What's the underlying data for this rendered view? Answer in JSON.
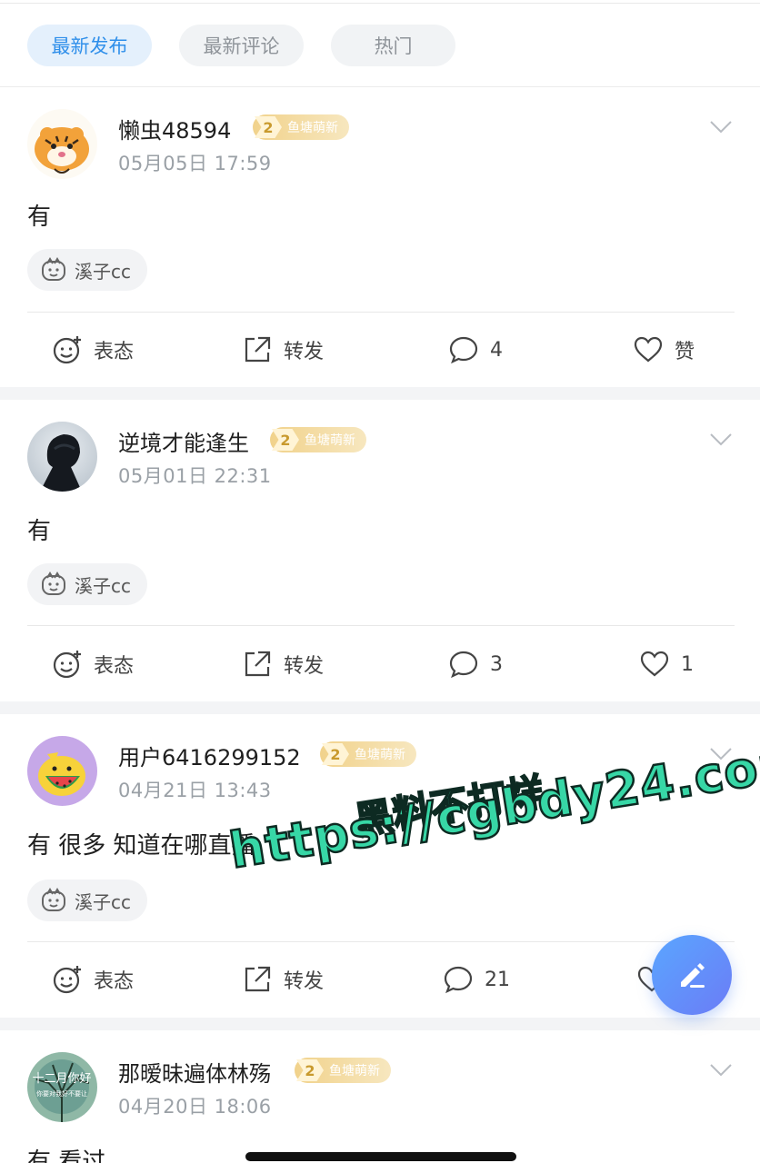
{
  "tabs": [
    {
      "label": "最新发布",
      "active": true
    },
    {
      "label": "最新评论",
      "active": false
    },
    {
      "label": "热门",
      "active": false
    }
  ],
  "posts": [
    {
      "username": "懒虫48594",
      "badge_level": "2",
      "badge_text": "鱼塘萌新",
      "time": "05月05日 17:59",
      "content": "有",
      "topic": "溪子cc",
      "actions": {
        "react": "表态",
        "share": "转发",
        "comments": "4",
        "like": "赞"
      }
    },
    {
      "username": "逆境才能逢生",
      "badge_level": "2",
      "badge_text": "鱼塘萌新",
      "time": "05月01日 22:31",
      "content": "有",
      "topic": "溪子cc",
      "actions": {
        "react": "表态",
        "share": "转发",
        "comments": "3",
        "like": "1"
      }
    },
    {
      "username": "用户6416299152",
      "badge_level": "2",
      "badge_text": "鱼塘萌新",
      "time": "04月21日 13:43",
      "content": "有 很多 知道在哪直播",
      "topic": "溪子cc",
      "actions": {
        "react": "表态",
        "share": "转发",
        "comments": "21",
        "like": ""
      }
    },
    {
      "username": "那暧昧遍体林殇",
      "badge_level": "2",
      "badge_text": "鱼塘萌新",
      "time": "04月20日 18:06",
      "content": "有   看过"
    }
  ],
  "avatar4_text": {
    "line1": "十二月你好",
    "line2": "你要对我好不要让"
  },
  "watermark": {
    "line1": "黑料不打烊",
    "line2": "https://cgbdy24.com"
  },
  "colors": {
    "accent": "#2f8fea",
    "badge": "#f1d28b",
    "fab": "#5aa6ff",
    "watermark": "#37d7a6"
  }
}
